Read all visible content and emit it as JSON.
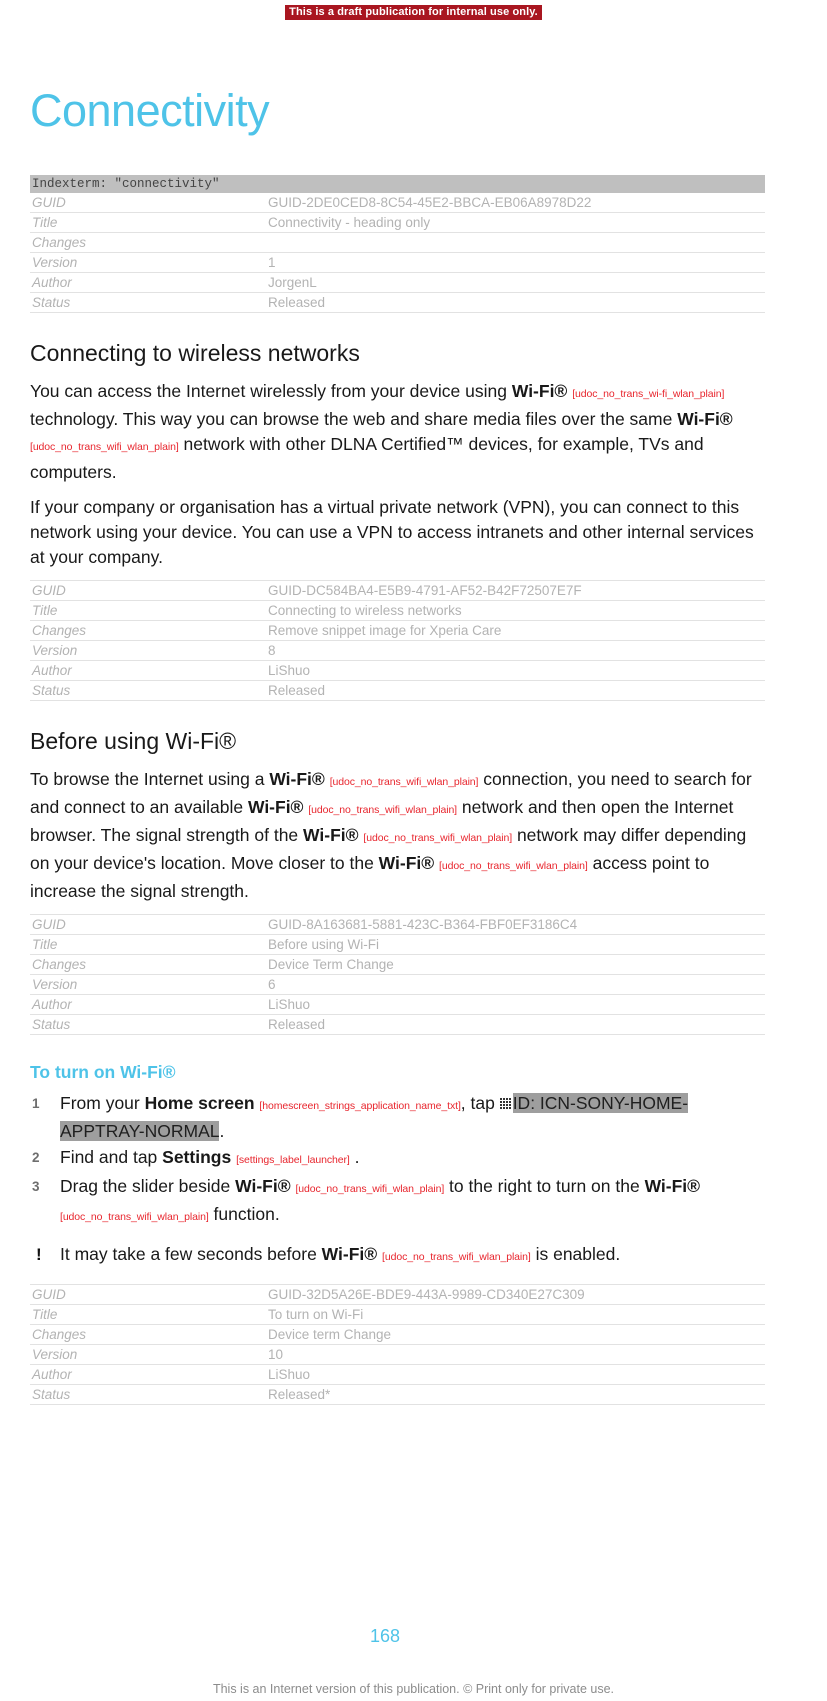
{
  "banner": {
    "draft_notice": "This is a draft publication for internal use only.",
    "color": "#a91620"
  },
  "chapter": {
    "title": "Connectivity",
    "accent_color": "#4ec3e8"
  },
  "indexterm": {
    "text": "Indexterm: \"connectivity\""
  },
  "meta_labels": {
    "guid": "GUID",
    "title": "Title",
    "changes": "Changes",
    "version": "Version",
    "author": "Author",
    "status": "Status"
  },
  "meta_tables": [
    {
      "guid": "GUID-2DE0CED8-8C54-45E2-BBCA-EB06A8978D22",
      "title": "Connectivity - heading only",
      "changes": "",
      "version": "1",
      "author": "JorgenL",
      "status": "Released"
    },
    {
      "guid": "GUID-DC584BA4-E5B9-4791-AF52-B42F72507E7F",
      "title": "Connecting to wireless networks",
      "changes": "Remove snippet image for Xperia Care",
      "version": "8",
      "author": "LiShuo",
      "status": "Released"
    },
    {
      "guid": "GUID-8A163681-5881-423C-B364-FBF0EF3186C4",
      "title": "Before using Wi-Fi",
      "changes": "Device Term Change",
      "version": "6",
      "author": "LiShuo",
      "status": "Released"
    },
    {
      "guid": "GUID-32D5A26E-BDE9-443A-9989-CD340E27C309",
      "title": "To turn on Wi-Fi",
      "changes": "Device term Change",
      "version": "10",
      "author": "LiShuo",
      "status": "Released*"
    }
  ],
  "sections": {
    "wireless": {
      "heading": "Connecting to wireless networks",
      "para1": {
        "p1": "You can access the Internet wirelessly from your device using ",
        "term1": "Wi-Fi®",
        "tag1": "[udoc_no_trans_wi-fi_wlan_plain]",
        "p2": " technology. This way you can browse the web and share media files over the same ",
        "term2": "Wi-Fi®",
        "tag2": "[udoc_no_trans_wifi_wlan_plain]",
        "p3": " network with other DLNA Certified™ devices, for example, TVs and computers."
      },
      "para2": "If your company or organisation has a virtual private network (VPN), you can connect to this network using your device. You can use a VPN to access intranets and other internal services at your company."
    },
    "before_wifi": {
      "heading": "Before using Wi-Fi®",
      "para": {
        "p1": "To browse the Internet using a ",
        "term1": "Wi-Fi®",
        "tag1": "[udoc_no_trans_wifi_wlan_plain]",
        "p2": " connection, you need to search for and connect to an available ",
        "term2": "Wi-Fi®",
        "tag2": "[udoc_no_trans_wifi_wlan_plain]",
        "p3": " network and then open the Internet browser. The signal strength of the ",
        "term3": "Wi-Fi®",
        "tag3": "[udoc_no_trans_wifi_wlan_plain]",
        "p4": " network may differ depending on your device's location. Move closer to the ",
        "term4": "Wi-Fi®",
        "tag4": "[udoc_no_trans_wifi_wlan_plain]",
        "p5": " access point to increase the signal strength."
      }
    },
    "turn_on_wifi": {
      "heading": "To turn on Wi-Fi®",
      "steps": [
        {
          "p1": "From your ",
          "term1": "Home screen",
          "tag1": "[homescreen_strings_application_name_txt]",
          "p2": ", tap ",
          "icon": "app-tray-grid-icon",
          "highlight": "ID: ICN-SONY-HOME-APPTRAY-NORMAL",
          "p3": "."
        },
        {
          "p1": "Find and tap ",
          "term1": "Settings",
          "tag1": "[settings_label_launcher]",
          "p2": " ."
        },
        {
          "p1": "Drag the slider beside ",
          "term1": "Wi-Fi®",
          "tag1": "[udoc_no_trans_wifi_wlan_plain]",
          "p2": " to the right to turn on the ",
          "term2": "Wi-Fi®",
          "tag2": "[udoc_no_trans_wifi_wlan_plain]",
          "p3": " function."
        }
      ],
      "note": {
        "marker": "!",
        "p1": "It may take a few seconds before ",
        "term1": "Wi-Fi®",
        "tag1": "[udoc_no_trans_wifi_wlan_plain]",
        "p2": " is enabled."
      }
    }
  },
  "footer": {
    "page_number": "168",
    "notice": "This is an Internet version of this publication. © Print only for private use."
  }
}
